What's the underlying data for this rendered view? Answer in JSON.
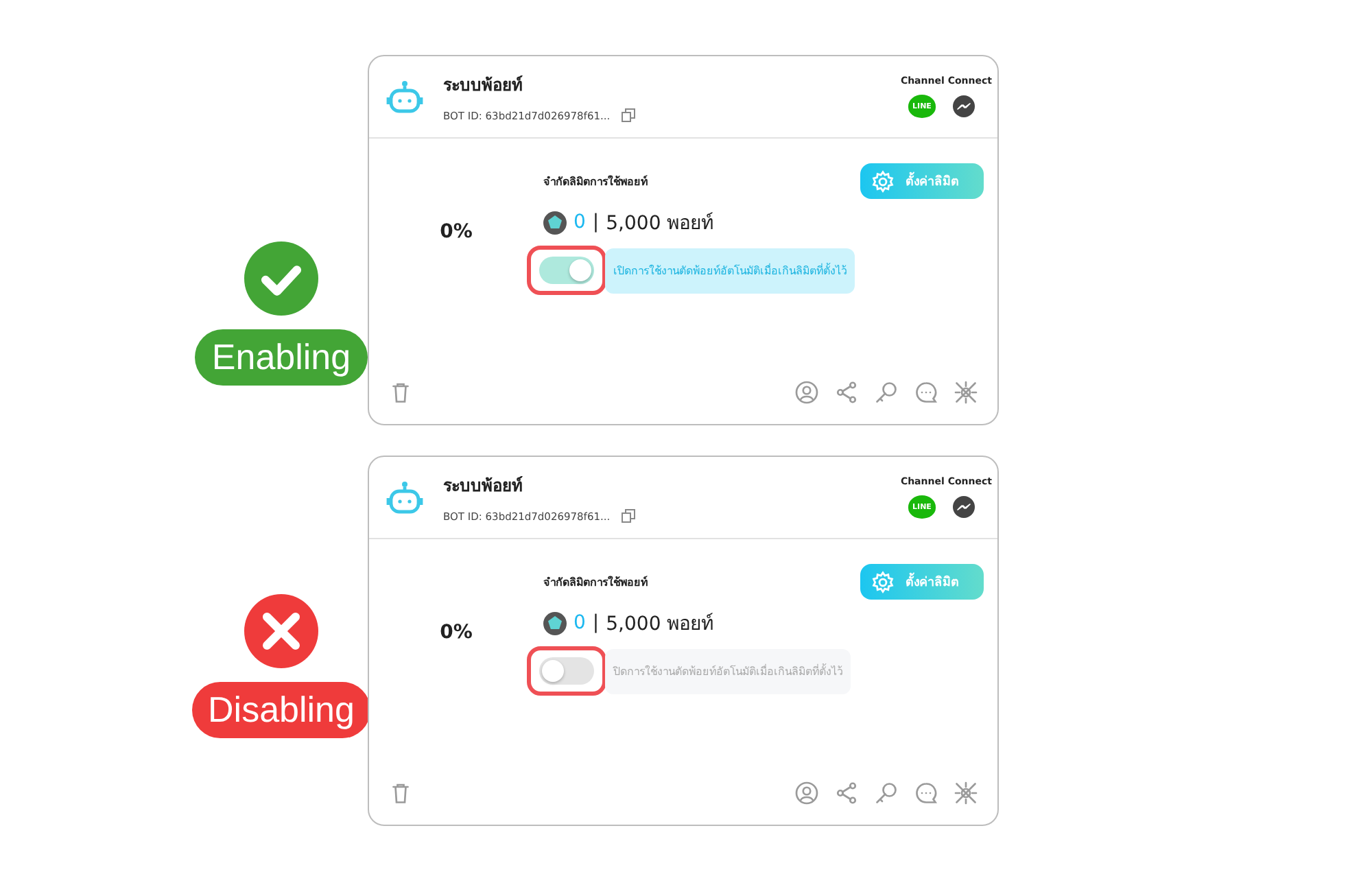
{
  "examples": [
    {
      "status": {
        "kind": "enabled",
        "label": "Enabling"
      },
      "card": {
        "title": "ระบบพ้อยท์",
        "bot_id": "BOT ID: 63bd21d7d026978f61...",
        "channel_heading": "Channel Connect",
        "line_label": "LINE",
        "limit_title": "จำกัดลิมิตการใช้พอยท์",
        "settings_button": "ตั้งค่าลิมิต",
        "percent": "0%",
        "used": "0",
        "separator": "|",
        "total": "5,000 พอยท์",
        "auto_cut": {
          "on": true,
          "highlighted": true,
          "label": "เปิดการใช้งานตัดพ้อยท์อัตโนมัติเมื่อเกินลิมิตที่ตั้งไว้"
        }
      }
    },
    {
      "status": {
        "kind": "disabled",
        "label": "Disabling"
      },
      "card": {
        "title": "ระบบพ้อยท์",
        "bot_id": "BOT ID: 63bd21d7d026978f61...",
        "channel_heading": "Channel Connect",
        "line_label": "LINE",
        "limit_title": "จำกัดลิมิตการใช้พอยท์",
        "settings_button": "ตั้งค่าลิมิต",
        "percent": "0%",
        "used": "0",
        "separator": "|",
        "total": "5,000 พอยท์",
        "auto_cut": {
          "on": false,
          "highlighted": true,
          "label": "ปิดการใช้งานตัดพ้อยท์อัตโนมัติเมื่อเกินลิมิตที่ตั้งไว้"
        }
      }
    }
  ]
}
